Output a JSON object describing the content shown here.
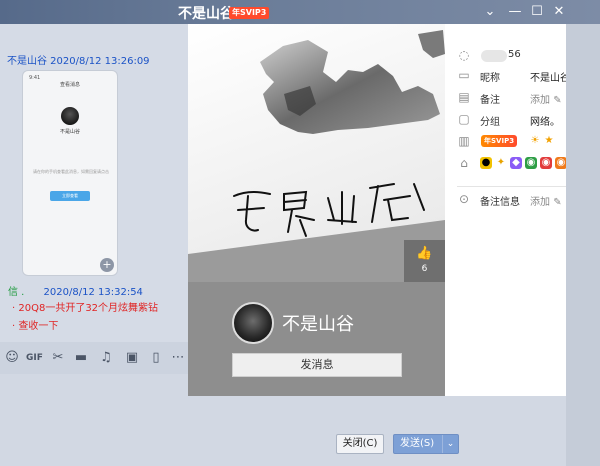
{
  "window": {
    "title": "不是山谷",
    "badge": "年SVIP3",
    "controls": [
      "⌄",
      "—",
      "☐",
      "✕"
    ]
  },
  "chat": {
    "msg1_time": "不是山谷 2020/8/12 13:26:09",
    "phone": {
      "header": "查看消息",
      "name": "不是山谷",
      "desc": "请在你的手机查看此消息，如需回复请点击",
      "button": "立即查看"
    },
    "msg2_sender": "信 .",
    "msg2_time": "2020/8/12 13:32:54",
    "red_line1": "20Q8一共开了32个月炫舞紫钻",
    "red_line2": "查收一下"
  },
  "toolbar": {
    "icons": [
      "emoji-icon",
      "gif-icon",
      "scissors-icon",
      "folder-icon",
      "music-icon",
      "image-icon",
      "phone-icon",
      "more-icon"
    ]
  },
  "actions": {
    "close_label": "关闭(C)",
    "send_label": "发送(S)",
    "send_caret": "⌄"
  },
  "profile": {
    "likes": "6",
    "nickname": "不是山谷",
    "message_button": "发消息",
    "qq_suffix": "56",
    "rows": {
      "nick_label": "昵称",
      "nick_value": "不是山谷",
      "remark_label": "备注",
      "remark_value": "添加",
      "group_label": "分组",
      "group_value": "网络。",
      "vip_badge": "年SVIP3",
      "remark_info_label": "备注信息",
      "remark_info_value": "添加"
    }
  }
}
